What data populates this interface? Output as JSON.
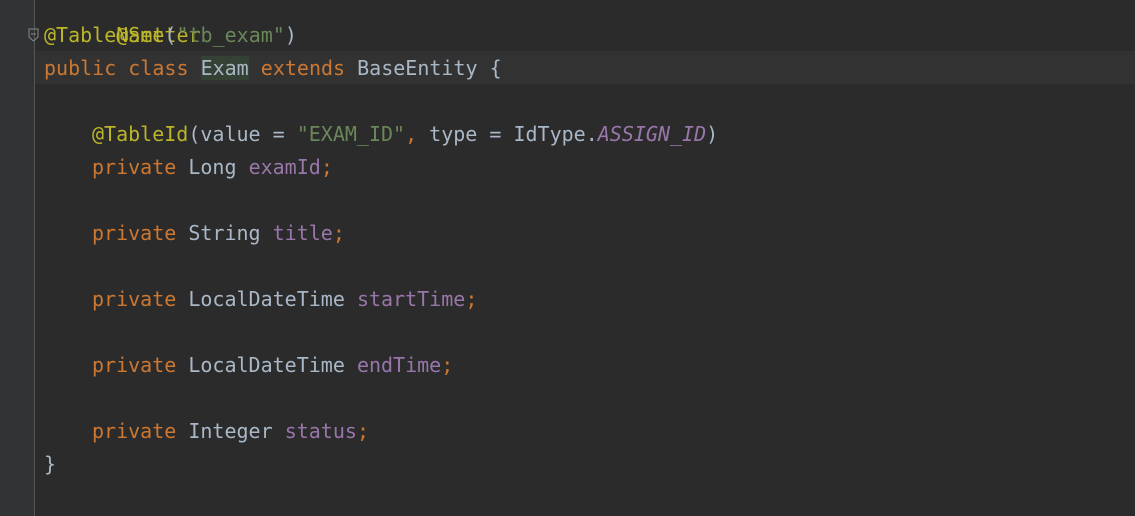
{
  "code": {
    "line0": {
      "annotation": "@Setter"
    },
    "line1": {
      "annotation": "@TableName",
      "open": "(",
      "string": "\"tb_exam\"",
      "close": ")"
    },
    "line2": {
      "kw1": "public",
      "kw2": "class",
      "class_name": "Exam",
      "kw3": "extends",
      "parent": "BaseEntity",
      "brace": "{"
    },
    "line4": {
      "annotation": "@TableId",
      "open": "(",
      "attr1": "value = ",
      "string": "\"EXAM_ID\"",
      "comma": ",",
      "attr2": " type = IdType.",
      "constant": "ASSIGN_ID",
      "close": ")"
    },
    "fields": [
      {
        "modifier": "private",
        "type": "Long",
        "name": "examId",
        "semicolon": ";"
      },
      {
        "modifier": "private",
        "type": "String",
        "name": "title",
        "semicolon": ";"
      },
      {
        "modifier": "private",
        "type": "LocalDateTime",
        "name": "startTime",
        "semicolon": ";"
      },
      {
        "modifier": "private",
        "type": "LocalDateTime",
        "name": "endTime",
        "semicolon": ";"
      },
      {
        "modifier": "private",
        "type": "Integer",
        "name": "status",
        "semicolon": ";"
      }
    ],
    "closing_brace": "}"
  },
  "icons": {
    "fold": "fold-marker-icon"
  },
  "colors": {
    "background": "#2b2b2b",
    "gutter": "#313335",
    "keyword": "#cc7832",
    "annotation": "#bbb529",
    "string": "#6a8759",
    "field": "#9876aa",
    "text": "#a9b7c6"
  }
}
